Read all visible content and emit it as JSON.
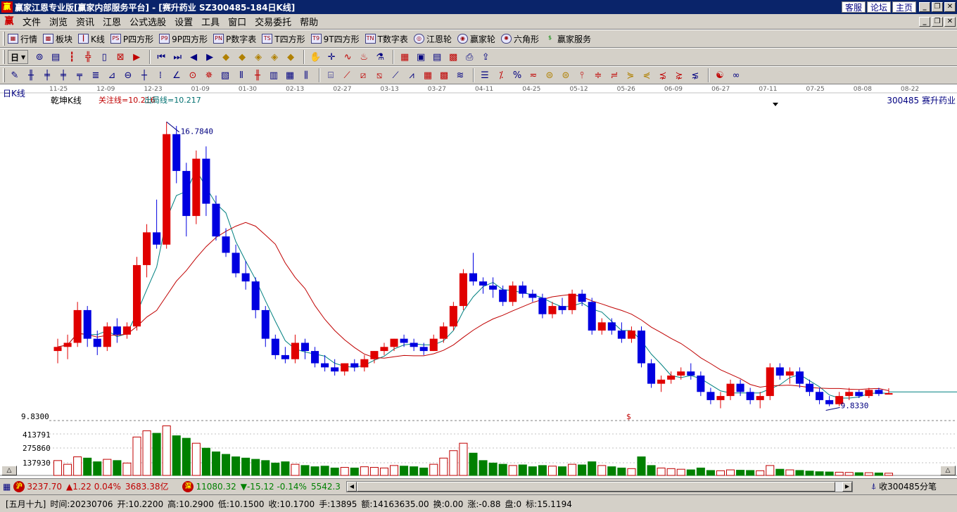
{
  "window": {
    "title": "赢家江恩专业版[赢家内部服务平台] - [赛升药业  SZ300485-184日K线]",
    "links": [
      "客服",
      "论坛",
      "主页"
    ]
  },
  "menu": {
    "logo": "赢",
    "items": [
      "文件",
      "浏览",
      "资讯",
      "江恩",
      "公式选股",
      "设置",
      "工具",
      "窗口",
      "交易委托",
      "帮助"
    ]
  },
  "nav": {
    "buttons": [
      "行情",
      "板块",
      "K线",
      "P四方形",
      "9P四方形",
      "P数字表",
      "T四方形",
      "9T四方形",
      "T数字表",
      "江恩轮",
      "赢家轮",
      "六角形",
      "赢家服务"
    ],
    "period": "日"
  },
  "chart_labels": {
    "ktype": "日K线",
    "indicator": "乾坤K线",
    "guanzhu": "关注线=10.216",
    "chuju": "出局线=10.217",
    "stock": "300485  赛升药业",
    "high_mark": "16.7840",
    "low_mark": "9.8330",
    "dollar_mark": "$",
    "price_axis": [
      "9.8300",
      "413791",
      "275860",
      "137930"
    ]
  },
  "chart_data": {
    "type": "candlestick",
    "x_ticks": [
      "11-25",
      "12-09",
      "12-23",
      "01-09",
      "01-30",
      "02-13",
      "02-27",
      "03-13",
      "03-27",
      "04-11",
      "04-25",
      "05-12",
      "05-26",
      "06-09",
      "06-27",
      "07-11",
      "07-25",
      "08-08",
      "08-22"
    ],
    "ylim": [
      9.5,
      17.2
    ],
    "candles": [
      [
        11.2,
        11.5,
        10.9,
        11.3
      ],
      [
        11.3,
        11.6,
        11.0,
        11.4
      ],
      [
        11.4,
        12.4,
        11.3,
        12.2
      ],
      [
        12.2,
        12.3,
        11.3,
        11.5
      ],
      [
        11.5,
        11.7,
        11.1,
        11.3
      ],
      [
        11.3,
        11.9,
        11.2,
        11.8
      ],
      [
        11.8,
        12.0,
        11.4,
        11.6
      ],
      [
        11.6,
        11.9,
        11.5,
        11.8
      ],
      [
        11.8,
        13.5,
        11.7,
        13.3
      ],
      [
        13.3,
        14.3,
        13.0,
        14.1
      ],
      [
        14.1,
        14.9,
        13.7,
        13.8
      ],
      [
        13.8,
        16.8,
        13.7,
        16.5
      ],
      [
        16.5,
        16.7,
        15.3,
        15.6
      ],
      [
        15.6,
        15.8,
        14.0,
        14.5
      ],
      [
        14.5,
        16.1,
        14.3,
        15.9
      ],
      [
        15.9,
        16.2,
        14.5,
        14.8
      ],
      [
        14.8,
        15.0,
        13.9,
        14.0
      ],
      [
        14.0,
        14.2,
        13.5,
        13.6
      ],
      [
        13.6,
        13.8,
        13.0,
        13.1
      ],
      [
        13.1,
        13.4,
        12.7,
        12.9
      ],
      [
        12.9,
        13.0,
        12.0,
        12.2
      ],
      [
        12.2,
        12.3,
        11.3,
        11.5
      ],
      [
        11.5,
        11.6,
        11.0,
        11.1
      ],
      [
        11.1,
        11.3,
        10.9,
        11.0
      ],
      [
        11.0,
        11.6,
        10.9,
        11.4
      ],
      [
        11.4,
        11.5,
        11.0,
        11.2
      ],
      [
        11.2,
        11.3,
        10.8,
        10.9
      ],
      [
        10.9,
        11.1,
        10.7,
        10.8
      ],
      [
        10.8,
        11.0,
        10.6,
        10.7
      ],
      [
        10.7,
        10.9,
        10.6,
        10.9
      ],
      [
        10.9,
        11.0,
        10.7,
        10.8
      ],
      [
        10.8,
        11.1,
        10.7,
        11.0
      ],
      [
        11.0,
        11.2,
        10.9,
        11.2
      ],
      [
        11.2,
        11.4,
        11.1,
        11.3
      ],
      [
        11.3,
        11.5,
        11.2,
        11.5
      ],
      [
        11.5,
        11.6,
        11.3,
        11.4
      ],
      [
        11.4,
        11.5,
        11.2,
        11.3
      ],
      [
        11.3,
        11.4,
        11.1,
        11.2
      ],
      [
        11.2,
        11.6,
        11.2,
        11.5
      ],
      [
        11.5,
        11.9,
        11.4,
        11.8
      ],
      [
        11.8,
        12.4,
        11.7,
        12.3
      ],
      [
        12.3,
        13.2,
        12.2,
        13.1
      ],
      [
        13.1,
        13.6,
        12.8,
        12.9
      ],
      [
        12.9,
        13.0,
        12.6,
        12.8
      ],
      [
        12.8,
        13.0,
        12.5,
        12.7
      ],
      [
        12.7,
        12.8,
        12.3,
        12.4
      ],
      [
        12.4,
        12.9,
        12.3,
        12.8
      ],
      [
        12.8,
        12.9,
        12.5,
        12.6
      ],
      [
        12.6,
        12.7,
        12.4,
        12.5
      ],
      [
        12.5,
        12.6,
        12.0,
        12.1
      ],
      [
        12.1,
        12.4,
        12.0,
        12.3
      ],
      [
        12.3,
        12.5,
        12.1,
        12.2
      ],
      [
        12.2,
        12.7,
        12.1,
        12.6
      ],
      [
        12.6,
        12.7,
        12.3,
        12.4
      ],
      [
        12.4,
        12.5,
        11.6,
        11.7
      ],
      [
        11.7,
        12.0,
        11.6,
        11.9
      ],
      [
        11.9,
        12.0,
        11.6,
        11.7
      ],
      [
        11.7,
        11.9,
        11.4,
        11.5
      ],
      [
        11.5,
        11.8,
        11.4,
        11.7
      ],
      [
        11.7,
        11.8,
        10.8,
        10.9
      ],
      [
        10.9,
        11.0,
        10.3,
        10.4
      ],
      [
        10.4,
        10.6,
        10.2,
        10.5
      ],
      [
        10.5,
        10.7,
        10.4,
        10.6
      ],
      [
        10.6,
        10.8,
        10.5,
        10.7
      ],
      [
        10.7,
        10.9,
        10.5,
        10.6
      ],
      [
        10.6,
        10.7,
        10.1,
        10.2
      ],
      [
        10.2,
        10.3,
        9.9,
        10.0
      ],
      [
        10.0,
        10.2,
        9.8,
        10.1
      ],
      [
        10.1,
        10.5,
        10.0,
        10.4
      ],
      [
        10.4,
        10.5,
        10.1,
        10.2
      ],
      [
        10.2,
        10.3,
        9.9,
        10.0
      ],
      [
        10.0,
        10.2,
        9.8,
        10.1
      ],
      [
        10.1,
        10.9,
        10.0,
        10.8
      ],
      [
        10.8,
        10.9,
        10.5,
        10.6
      ],
      [
        10.6,
        10.8,
        10.4,
        10.7
      ],
      [
        10.7,
        10.8,
        10.3,
        10.4
      ],
      [
        10.4,
        10.5,
        10.1,
        10.2
      ],
      [
        10.2,
        10.3,
        9.9,
        10.0
      ],
      [
        10.0,
        10.1,
        9.85,
        9.9
      ],
      [
        9.9,
        10.2,
        9.85,
        10.1
      ],
      [
        10.1,
        10.3,
        10.0,
        10.2
      ],
      [
        10.2,
        10.25,
        10.05,
        10.1
      ],
      [
        10.1,
        10.3,
        10.05,
        10.25
      ],
      [
        10.25,
        10.3,
        10.1,
        10.15
      ],
      [
        10.15,
        10.29,
        10.15,
        10.17
      ]
    ],
    "volume": [
      120000,
      90000,
      150000,
      140000,
      110000,
      130000,
      120000,
      100000,
      310000,
      360000,
      340000,
      400000,
      320000,
      300000,
      260000,
      220000,
      190000,
      170000,
      150000,
      140000,
      130000,
      120000,
      100000,
      110000,
      90000,
      80000,
      70000,
      75000,
      60000,
      65000,
      60000,
      70000,
      65000,
      60000,
      80000,
      75000,
      70000,
      60000,
      90000,
      140000,
      200000,
      260000,
      180000,
      120000,
      100000,
      90000,
      80000,
      85000,
      70000,
      80000,
      75000,
      70000,
      90000,
      85000,
      110000,
      80000,
      70000,
      60000,
      55000,
      150000,
      80000,
      60000,
      55000,
      50000,
      45000,
      60000,
      40000,
      38000,
      45000,
      42000,
      40000,
      38000,
      80000,
      50000,
      45000,
      40000,
      35000,
      30000,
      28000,
      26000,
      24000,
      22000,
      22000,
      20000,
      18000
    ]
  },
  "index_bar": {
    "sh_badge": "沪",
    "sh_value": "3237.70",
    "sh_change": "▲1.22 0.04%",
    "sh_amount": "3683.38亿",
    "sz_badge": "深",
    "sz_value": "11080.32",
    "sz_change": "▼-15.12 -0.14%",
    "sz_amount": "5542.3",
    "tick_label": "收300485分笔"
  },
  "status": {
    "date": "[五月十九]",
    "time": "时间:20230706",
    "open": "开:10.2200",
    "high": "高:10.2900",
    "low": "低:10.1500",
    "close": "收:10.1700",
    "hand": "手:13895",
    "amount": "额:14163635.00",
    "turnover": "换:0.00",
    "change": "涨:-0.88",
    "pan": "盘:0",
    "biao": "标:15.1194"
  },
  "colors": {
    "up": "#e00000",
    "down": "#0000e0",
    "flat": "#800080",
    "ma_short": "#008080",
    "ma_long": "#c00000",
    "vol_up": "#c00000",
    "vol_down": "#008000"
  }
}
